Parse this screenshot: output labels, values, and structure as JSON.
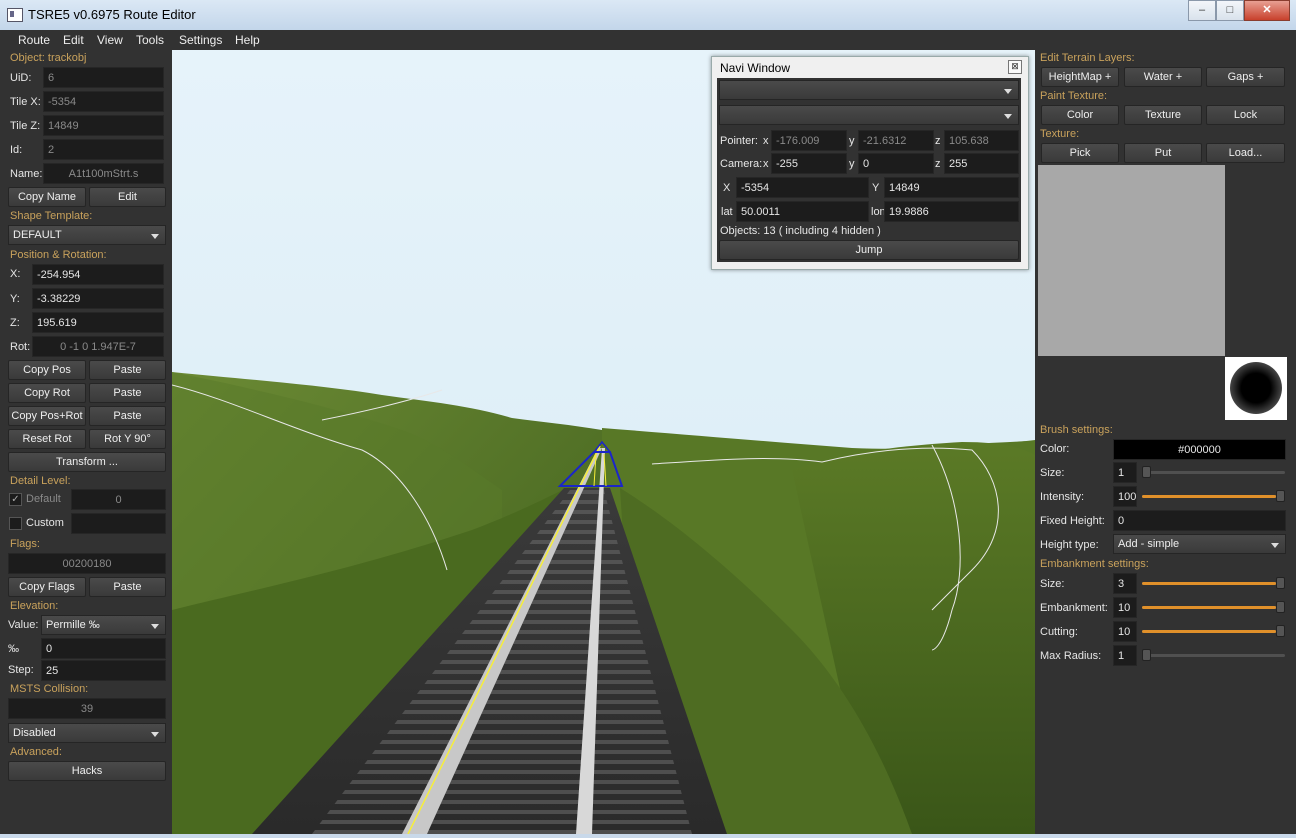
{
  "window": {
    "title": "TSRE5 v0.6975 Route Editor",
    "minimize": "–",
    "maximize": "□",
    "close": "✕"
  },
  "menu": [
    "Route",
    "Edit",
    "View",
    "Tools",
    "Settings",
    "Help"
  ],
  "left": {
    "object_header": "Object: trackobj",
    "uid_label": "UiD:",
    "uid": "6",
    "tilex_label": "Tile X:",
    "tilex": "-5354",
    "tilez_label": "Tile Z:",
    "tilez": "14849",
    "id_label": "Id:",
    "id": "2",
    "name_label": "Name:",
    "name": "A1t100mStrt.s",
    "copy_name": "Copy Name",
    "edit": "Edit",
    "shape_template_header": "Shape Template:",
    "shape_template": "DEFAULT",
    "posrot_header": "Position & Rotation:",
    "x_label": "X:",
    "x": "-254.954",
    "y_label": "Y:",
    "y": "-3.38229",
    "z_label": "Z:",
    "z": "195.619",
    "rot_label": "Rot:",
    "rot": "0 -1 0 1.947E-7",
    "copy_pos": "Copy Pos",
    "paste1": "Paste",
    "copy_rot": "Copy Rot",
    "paste2": "Paste",
    "copy_posrot": "Copy Pos+Rot",
    "paste3": "Paste",
    "reset_rot": "Reset Rot",
    "rot_y90": "Rot Y 90°",
    "transform": "Transform ...",
    "detail_header": "Detail Level:",
    "default_check": "✓",
    "default_label": "Default",
    "default_value": "0",
    "custom_label": "Custom",
    "flags_header": "Flags:",
    "flags": "00200180",
    "copy_flags": "Copy Flags",
    "paste4": "Paste",
    "elevation_header": "Elevation:",
    "value_label": "Value:",
    "value": "Permille ‰",
    "permille_label": "‰",
    "permille": "0",
    "step_label": "Step:",
    "step": "25",
    "collision_header": "MSTS Collision:",
    "collision": "39",
    "collision_mode": "Disabled",
    "advanced_header": "Advanced:",
    "hacks": "Hacks"
  },
  "navi": {
    "title": "Navi Window",
    "close": "⊠",
    "pointer_label": "Pointer:",
    "px_l": "x",
    "px": "-176.009",
    "py_l": "y",
    "py": "-21.6312",
    "pz_l": "z",
    "pz": "105.638",
    "camera_label": "Camera:",
    "cx_l": "x",
    "cx": "-255",
    "cy_l": "y",
    "cy": "0",
    "cz_l": "z",
    "cz": "255",
    "tx_l": "X",
    "tx": "-5354",
    "ty_l": "Y",
    "ty": "14849",
    "lat_l": "lat",
    "lat": "50.0011",
    "lon_l": "lon",
    "lon": "19.9886",
    "objects": "Objects: 13 ( including 4 hidden )",
    "jump": "Jump"
  },
  "right": {
    "terrain_header": "Edit Terrain Layers:",
    "heightmap": "HeightMap +",
    "water": "Water +",
    "gaps": "Gaps +",
    "paint_header": "Paint Texture:",
    "color_btn": "Color",
    "texture_btn": "Texture",
    "lock_btn": "Lock",
    "texture_header": "Texture:",
    "pick": "Pick",
    "put": "Put",
    "load": "Load...",
    "brush_header": "Brush settings:",
    "color_label": "Color:",
    "color_value": "#000000",
    "size_label": "Size:",
    "size": "1",
    "intensity_label": "Intensity:",
    "intensity": "100",
    "fixed_label": "Fixed Height:",
    "fixed": "0",
    "htype_label": "Height type:",
    "htype": "Add - simple",
    "emb_header": "Embankment settings:",
    "esize_label": "Size:",
    "esize": "3",
    "emb_label": "Embankment:",
    "emb": "10",
    "cut_label": "Cutting:",
    "cut": "10",
    "maxr_label": "Max Radius:",
    "maxr": "1"
  },
  "colors": {
    "panel": "#323232",
    "field": "#1c1c1c",
    "accent": "#e0902a",
    "section": "#c9a25c",
    "sky": "#e3f1f8",
    "grass": "#5a7a2a"
  }
}
